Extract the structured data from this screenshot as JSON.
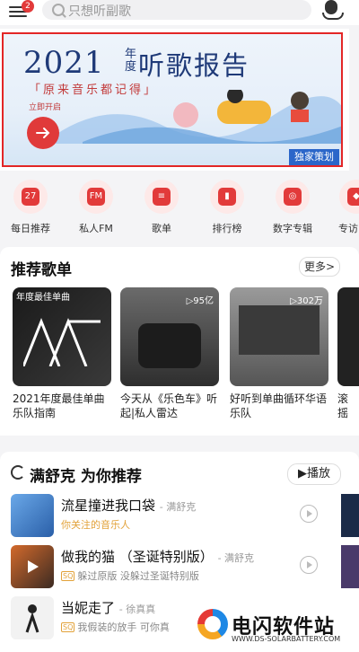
{
  "header": {
    "badge_count": "2",
    "search_placeholder": "只想听副歌"
  },
  "banner": {
    "year": "2021",
    "year_suffix": "年度",
    "title": "听歌报告",
    "subtitle": "「原来音乐都记得」",
    "enter_label": "立即开启",
    "tag": "独家策划"
  },
  "shortcuts": [
    {
      "label": "每日推荐",
      "icon": "calendar-icon",
      "glyph": "27"
    },
    {
      "label": "私人FM",
      "icon": "radio-icon",
      "glyph": "FM"
    },
    {
      "label": "歌单",
      "icon": "playlist-icon",
      "glyph": "≡"
    },
    {
      "label": "排行榜",
      "icon": "chart-icon",
      "glyph": "▮"
    },
    {
      "label": "数字专辑",
      "icon": "album-icon",
      "glyph": "◎"
    },
    {
      "label": "专访",
      "icon": "interview-icon",
      "glyph": "◆"
    }
  ],
  "playlists": {
    "section_title": "推荐歌单",
    "more_label": "更多>",
    "items": [
      {
        "title": "2021年度最佳单曲乐队指南",
        "count": "",
        "cover_text": "年度最佳单曲"
      },
      {
        "title": "今天从《乐色车》听起|私人雷达",
        "count": "▷95亿",
        "cover_text": ""
      },
      {
        "title": "好听到单曲循环华语乐队",
        "count": "▷302万",
        "cover_text": ""
      },
      {
        "title": "滚摇",
        "count": "",
        "cover_text": ""
      }
    ]
  },
  "recommend": {
    "title": "满舒克 为你推荐",
    "play_label": "▶播放",
    "songs": [
      {
        "name": "流星撞进我口袋",
        "artist": "- 满舒克",
        "sub": "你关注的音乐人",
        "sq": false
      },
      {
        "name": "做我的猫 （圣诞特别版）",
        "artist": "- 满舒克",
        "sub": "躲过原版 没躲过圣诞特别版",
        "sq": true
      },
      {
        "name": "当妮走了",
        "artist": "- 徐真真",
        "sub": "我假装的放手 可你真",
        "sq": true
      }
    ]
  },
  "watermark": {
    "text": "电闪软件站",
    "url": "WWW.DS-SOLARBATTERY.COM"
  },
  "colors": {
    "accent": "#e23a3a",
    "banner_frame": "#e32626",
    "banner_tag": "#2b66c9",
    "title_blue": "#1f3a78"
  }
}
